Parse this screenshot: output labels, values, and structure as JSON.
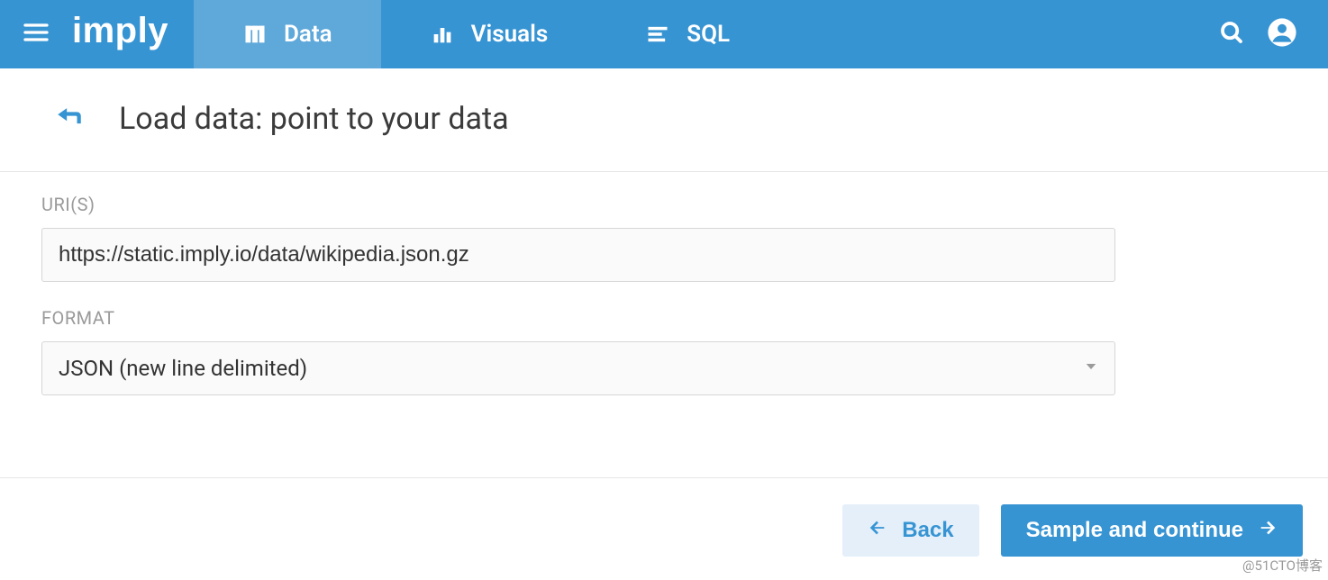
{
  "brand": "imply",
  "nav": {
    "tabs": [
      {
        "label": "Data",
        "active": true
      },
      {
        "label": "Visuals",
        "active": false
      },
      {
        "label": "SQL",
        "active": false
      }
    ]
  },
  "page": {
    "title": "Load data: point to your data"
  },
  "form": {
    "uris_label": "URI(S)",
    "uris_value": "https://static.imply.io/data/wikipedia.json.gz",
    "format_label": "FORMAT",
    "format_value": "JSON (new line delimited)"
  },
  "footer": {
    "back_label": "Back",
    "continue_label": "Sample and continue"
  },
  "watermark": "@51CTO博客"
}
